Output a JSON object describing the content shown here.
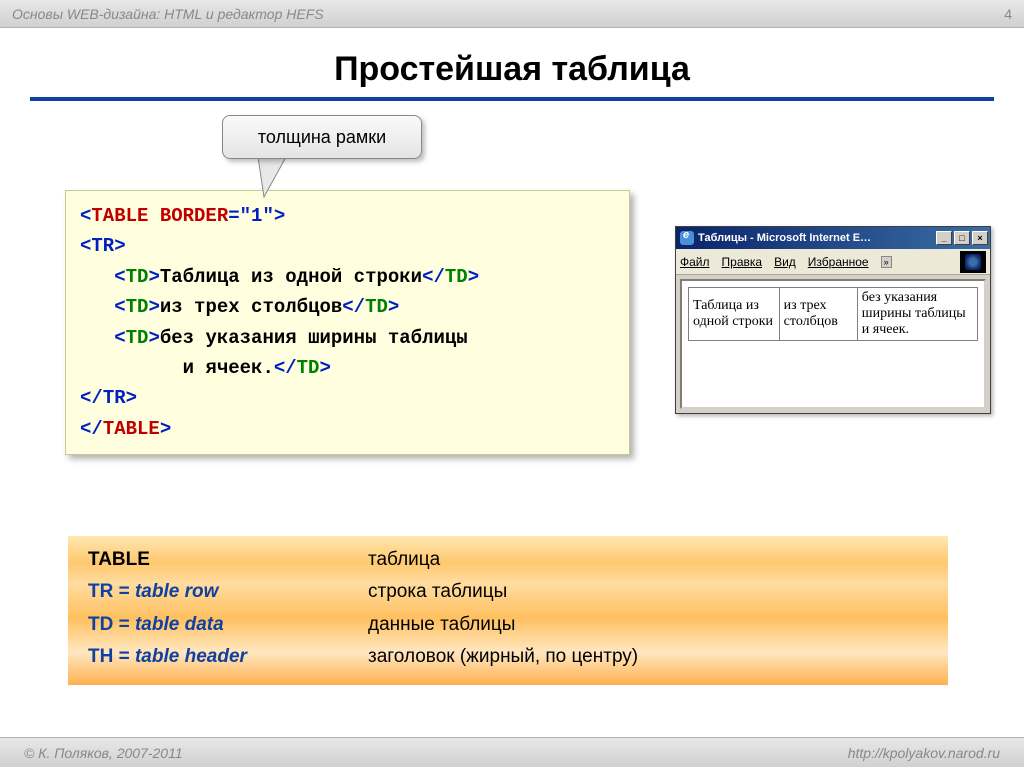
{
  "header": {
    "title": "Основы WEB-дизайна: HTML и редактор HEFS",
    "page_number": "4"
  },
  "slide_title": "Простейшая таблица",
  "callout_label": "толщина рамки",
  "code": {
    "line1_open": "<",
    "line1_table": "TABLE",
    "line1_border_attr": " BORDER",
    "line1_border_val": "=\"1\"",
    "line1_close": ">",
    "tr_open": "<TR>",
    "td_open": "<TD>",
    "td_close": "</TD>",
    "cell1_text": "Таблица из одной строки",
    "cell2_text": "из трех столбцов",
    "cell3_text_a": "без указания ширины таблицы",
    "cell3_text_b": "и ячеек.",
    "tr_close": "</TR>",
    "table_close": "</TABLE>"
  },
  "browser": {
    "window_title": "Таблицы - Microsoft Internet E…",
    "menu": {
      "file": "Файл",
      "edit": "Правка",
      "view": "Вид",
      "favorites": "Избранное",
      "chevron": "»"
    },
    "cells": {
      "c1": "Таблица из одной строки",
      "c2": "из трех столбцов",
      "c3": "без указания ширины таблицы и ячеек."
    }
  },
  "definitions": [
    {
      "term": "TABLE",
      "italic": "",
      "desc": "таблица",
      "term_black": true
    },
    {
      "term": "TR = ",
      "italic": "table row",
      "desc": "строка таблицы"
    },
    {
      "term": "TD = ",
      "italic": "table data",
      "desc": "данные таблицы"
    },
    {
      "term": "TH = ",
      "italic": "table header",
      "desc": "заголовок (жирный, по центру)"
    }
  ],
  "footer": {
    "copyright": "© К. Поляков, 2007-2011",
    "url": "http://kpolyakov.narod.ru"
  }
}
